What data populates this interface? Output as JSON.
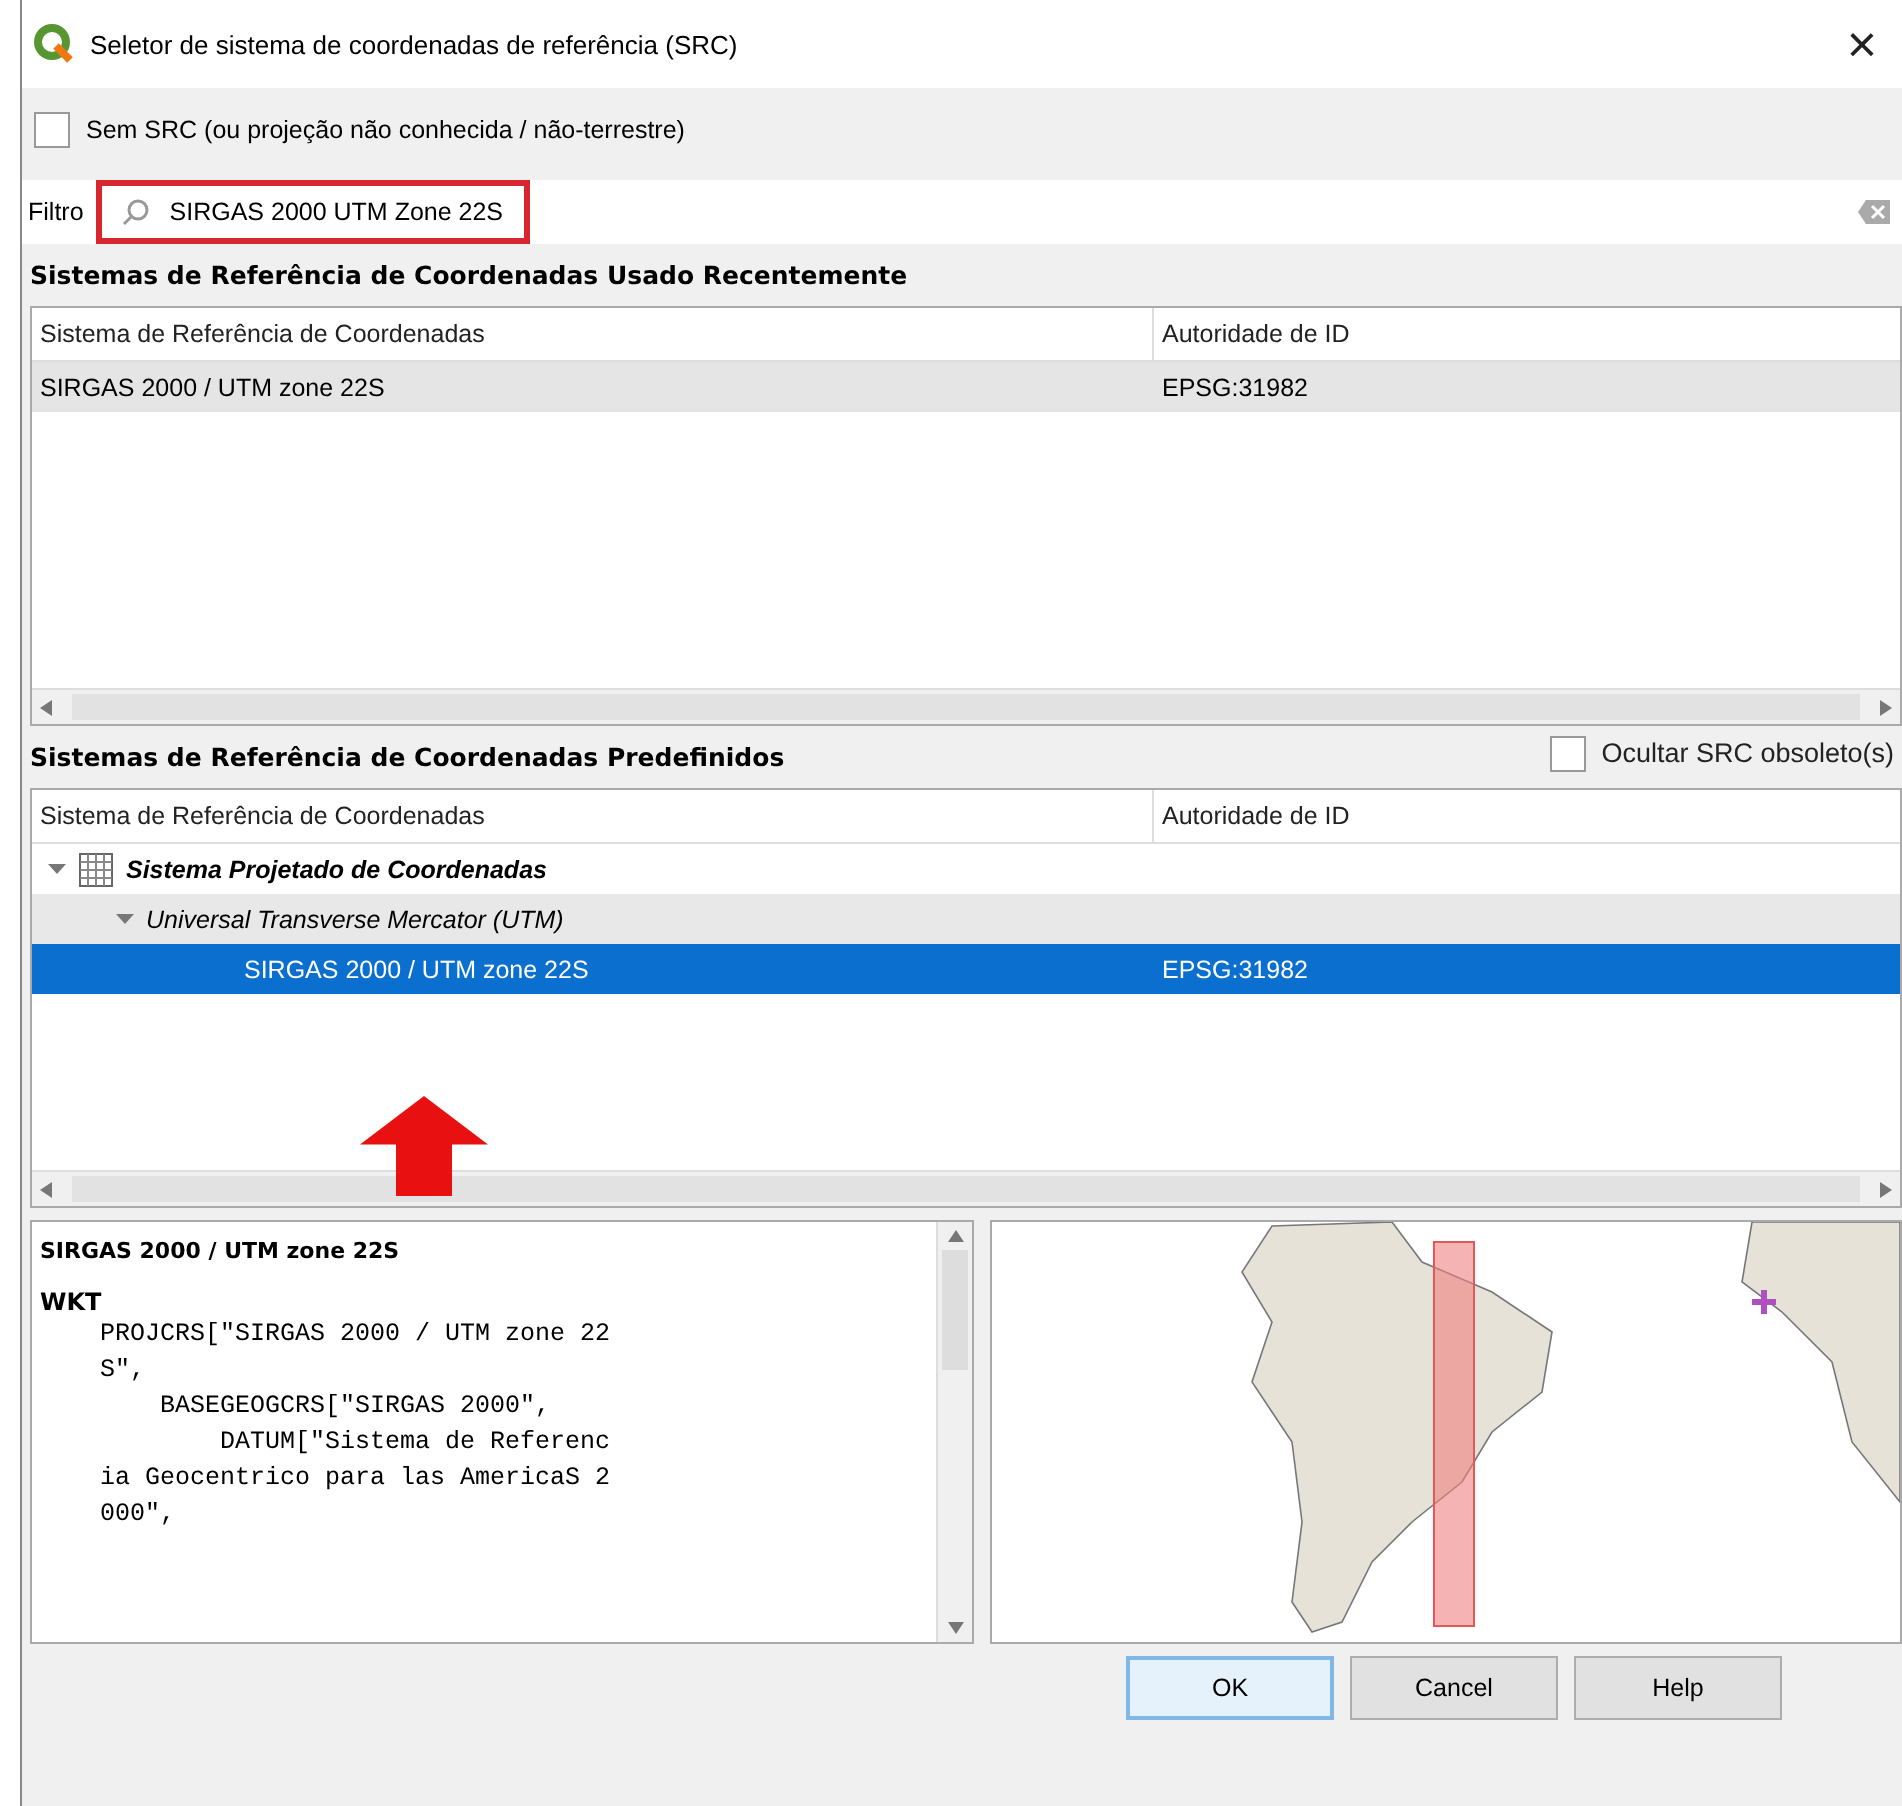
{
  "window": {
    "title": "Seletor de sistema de coordenadas de referência (SRC)",
    "close": "×"
  },
  "no_crs": {
    "label": "Sem SRC (ou projeção não conhecida / não-terrestre)",
    "checked": false
  },
  "filter": {
    "label": "Filtro",
    "value": "SIRGAS 2000 UTM Zone 22S"
  },
  "recent": {
    "heading": "Sistemas de Referência de Coordenadas Usado Recentemente",
    "columns": [
      "Sistema de Referência de Coordenadas",
      "Autoridade de ID"
    ],
    "rows": [
      {
        "name": "SIRGAS 2000 / UTM zone 22S",
        "authority": "EPSG:31982",
        "selected": true
      }
    ]
  },
  "predefined": {
    "heading": "Sistemas de Referência de Coordenadas Predefinidos",
    "hide_deprecated": {
      "label": "Ocultar SRC obsoleto(s)",
      "checked": false
    },
    "columns": [
      "Sistema de Referência de Coordenadas",
      "Autoridade de ID"
    ],
    "tree": [
      {
        "kind": "category",
        "label": "Sistema Projetado de Coordenadas",
        "expanded": true,
        "children": [
          {
            "kind": "projection",
            "label": "Universal Transverse Mercator (UTM)",
            "expanded": true,
            "children": [
              {
                "kind": "crs",
                "label": "SIRGAS 2000 / UTM zone 22S",
                "authority": "EPSG:31982",
                "selected": true
              }
            ]
          }
        ]
      }
    ]
  },
  "details": {
    "title": "SIRGAS 2000 / UTM zone 22S",
    "section": "WKT",
    "wkt_lines": [
      "    PROJCRS[\"SIRGAS 2000 / UTM zone 22",
      "    S\",",
      "        BASEGEOGCRS[\"SIRGAS 2000\",",
      "            DATUM[\"Sistema de Referenc",
      "    ia Geocentrico para las AmericaS 2",
      "    000\","
    ]
  },
  "buttons": [
    "OK",
    "Cancel",
    "Help"
  ]
}
